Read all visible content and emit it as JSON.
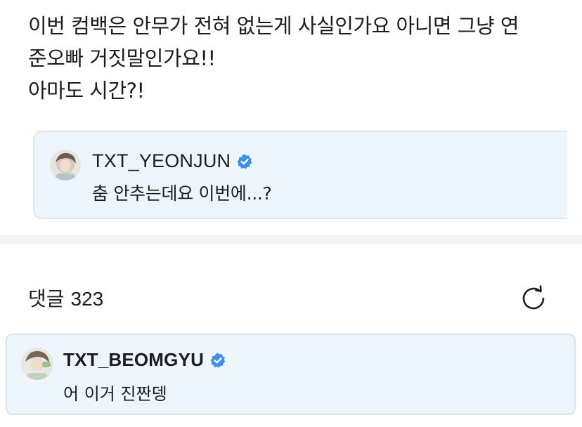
{
  "post": {
    "lines": [
      "이번 컴백은 안무가 전혀 없는게 사실인가요 아니면 그냥 연",
      "준오빠 거짓말인가요!!",
      "아마도 시간?!"
    ]
  },
  "quoted_post": {
    "author": "TXT_YEONJUN",
    "verified_icon": "verified-badge-icon",
    "text": "춤 안추는데요 이번에...?"
  },
  "comments": {
    "label": "댓글",
    "count": "323",
    "refresh_icon": "refresh-icon",
    "items": [
      {
        "author": "TXT_BEOMGYU",
        "verified_icon": "verified-badge-icon",
        "text": "어 이거 진짠뎅"
      }
    ]
  },
  "colors": {
    "card_background": "#eef6fd",
    "card_border": "#dde7f0",
    "verified_badge": "#3e8eea",
    "divider": "#f3f4f6",
    "text": "#1c1c1e"
  }
}
